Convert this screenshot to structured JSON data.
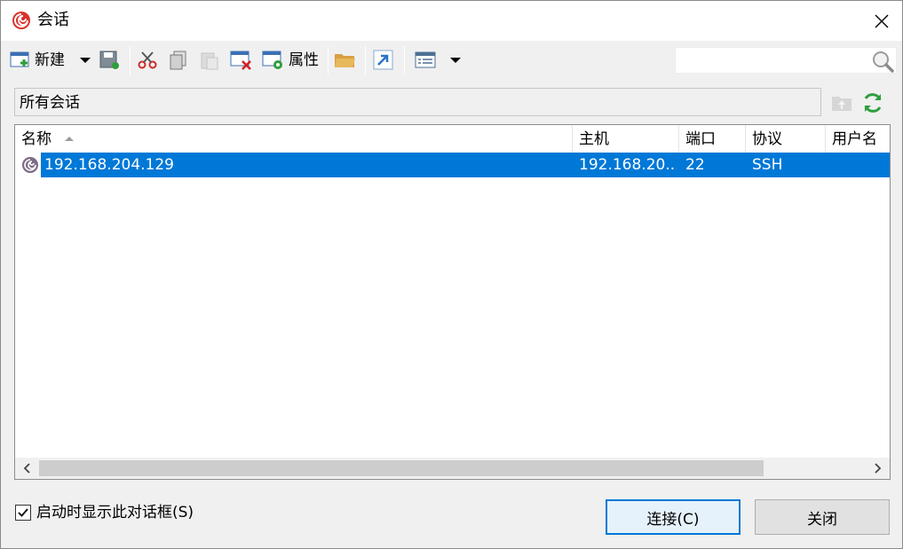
{
  "window": {
    "title": "会话"
  },
  "toolbar": {
    "new_label": "新建",
    "properties_label": "属性",
    "search_value": "",
    "search_placeholder": ""
  },
  "path": {
    "label": "所有会话"
  },
  "list": {
    "columns": [
      {
        "label": "名称",
        "sorted": "ascending"
      },
      {
        "label": "主机"
      },
      {
        "label": "端口"
      },
      {
        "label": "协议"
      },
      {
        "label": "用户名"
      }
    ],
    "rows": [
      {
        "name": "192.168.204.129",
        "host": "192.168.20...",
        "port": "22",
        "protocol": "SSH",
        "user": "",
        "selected": true
      }
    ]
  },
  "footer": {
    "startup_checkbox_label": "启动时显示此对话框(S)",
    "startup_checked": true,
    "connect_label": "连接(C)",
    "close_label": "关闭"
  },
  "colors": {
    "selection": "#0078d7",
    "accent_red": "#d9312b"
  }
}
